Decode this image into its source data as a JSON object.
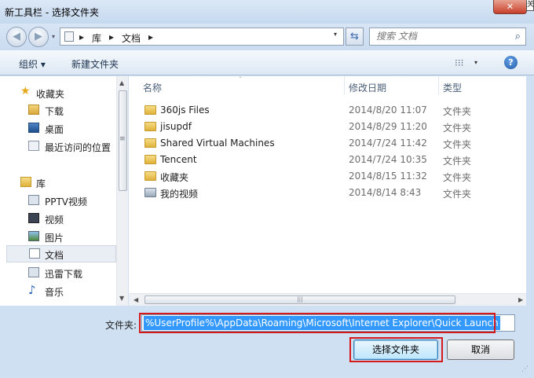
{
  "window": {
    "title": "新工具栏 - 选择文件夹",
    "close_glyph": "✕",
    "corner_glyph": "关"
  },
  "nav": {
    "back_glyph": "◀",
    "forward_glyph": "▶",
    "dropdown_glyph": "▾"
  },
  "address": {
    "crumbs": [
      "库",
      "文档"
    ],
    "separator": "▸",
    "dropdown_glyph": "▾",
    "refresh_glyph": "⇆"
  },
  "search": {
    "placeholder": "搜索 文档",
    "icon": "search-icon"
  },
  "toolbar": {
    "organize_label": "组织 ▾",
    "new_folder_label": "新建文件夹",
    "view_glyph": "⁝⁝⁝",
    "view_dd": "▾",
    "help_glyph": "?"
  },
  "sidebar": {
    "favorites": {
      "label": "收藏夹",
      "icon": "star-icon"
    },
    "favorites_items": [
      {
        "label": "下载",
        "icon": "download-icon"
      },
      {
        "label": "桌面",
        "icon": "desktop-icon"
      },
      {
        "label": "最近访问的位置",
        "icon": "recent-places-icon"
      }
    ],
    "libraries": {
      "label": "库",
      "icon": "library-icon"
    },
    "library_items": [
      {
        "label": "PPTV视频",
        "icon": "video-library-icon"
      },
      {
        "label": "视频",
        "icon": "video-library-icon"
      },
      {
        "label": "图片",
        "icon": "pictures-library-icon"
      },
      {
        "label": "文档",
        "icon": "documents-library-icon",
        "selected": true
      },
      {
        "label": "迅雷下载",
        "icon": "download-library-icon"
      },
      {
        "label": "音乐",
        "icon": "music-library-icon"
      }
    ],
    "scroll_up": "▲",
    "scroll_down": "▼",
    "scroll_mid": "≡"
  },
  "file_list": {
    "columns": {
      "name": "名称",
      "date": "修改日期",
      "type": "类型"
    },
    "sort_glyph": "ˆ",
    "rows": [
      {
        "name": "360js Files",
        "date": "2014/8/20 11:07",
        "type": "文件夹"
      },
      {
        "name": "jisupdf",
        "date": "2014/8/29 11:20",
        "type": "文件夹"
      },
      {
        "name": "Shared Virtual Machines",
        "date": "2014/7/24 11:42",
        "type": "文件夹"
      },
      {
        "name": "Tencent",
        "date": "2014/7/24 10:35",
        "type": "文件夹"
      },
      {
        "name": "收藏夹",
        "date": "2014/8/15 11:32",
        "type": "文件夹"
      },
      {
        "name": "我的视频",
        "date": "2014/8/14 8:43",
        "type": "文件夹"
      }
    ],
    "hscroll_left": "◀",
    "hscroll_right": "▶",
    "hscroll_grip": "|||"
  },
  "footer": {
    "folder_label": "文件夹:",
    "folder_value": "%UserProfile%\\AppData\\Roaming\\Microsoft\\Internet Explorer\\Quick Launch",
    "select_button": "选择文件夹",
    "cancel_button": "取消",
    "highlight_color": "#d41a1a",
    "grip": "⋰"
  }
}
